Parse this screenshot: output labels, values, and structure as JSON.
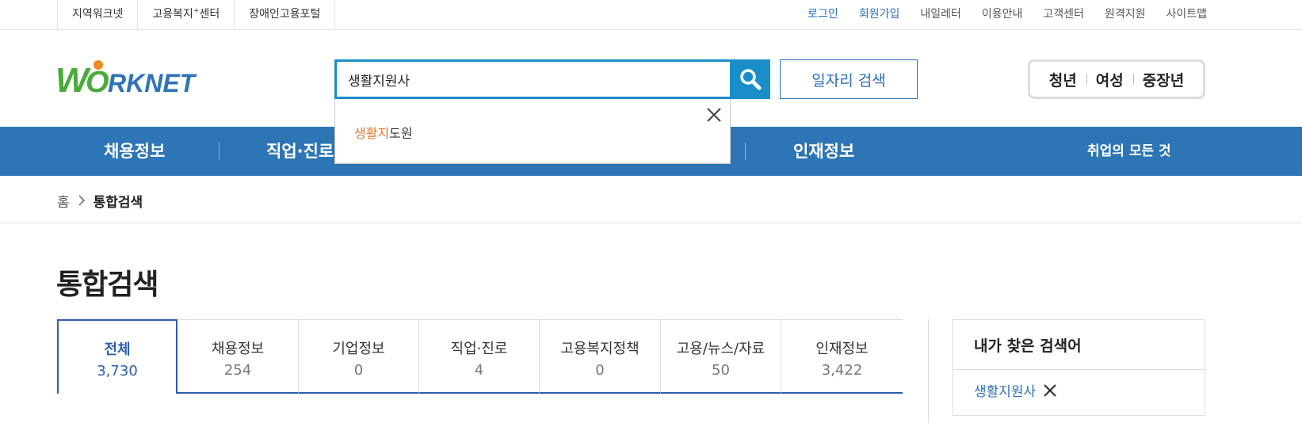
{
  "top_left_links": {
    "worknet_local": "지역워크넷",
    "welfare_center_pre": "고용복지",
    "welfare_center_sup": "+",
    "welfare_center_post": "센터",
    "disabled_portal": "장애인고용포털"
  },
  "top_right_links": {
    "login": "로그인",
    "signup": "회원가입",
    "my_letter": "내일레터",
    "guide": "이용안내",
    "customer": "고객센터",
    "remote": "원격지원",
    "sitemap": "사이트맵"
  },
  "logo": {
    "letter_w": "W",
    "letter_o": "O",
    "rest": "RKNET"
  },
  "search": {
    "value": "생활지원사"
  },
  "job_search_label": "일자리 검색",
  "age_tabs": {
    "youth": "청년",
    "women": "여성",
    "middle": "중장년"
  },
  "gnb": {
    "jobs": "채용정보",
    "career": "직업·진로",
    "talent": "인재정보",
    "all_about": "취업의 모든 것"
  },
  "suggest": {
    "highlight": "생활지",
    "rest": "도원"
  },
  "breadcrumb": {
    "home": "홈",
    "current": "통합검색"
  },
  "page_title": "통합검색",
  "tabs": [
    {
      "label": "전체",
      "count": "3,730"
    },
    {
      "label": "채용정보",
      "count": "254"
    },
    {
      "label": "기업정보",
      "count": "0"
    },
    {
      "label": "직업·진로",
      "count": "4"
    },
    {
      "label": "고용복지정책",
      "count": "0"
    },
    {
      "label": "고용/뉴스/자료",
      "count": "50"
    },
    {
      "label": "인재정보",
      "count": "3,422"
    }
  ],
  "history": {
    "title": "내가 찾은 검색어",
    "item": "생활지원사"
  },
  "colors": {
    "accent": "#1a8ec9",
    "gnb": "#2d75b4",
    "tab_active": "#2d5fae",
    "highlight": "#e6782b"
  }
}
